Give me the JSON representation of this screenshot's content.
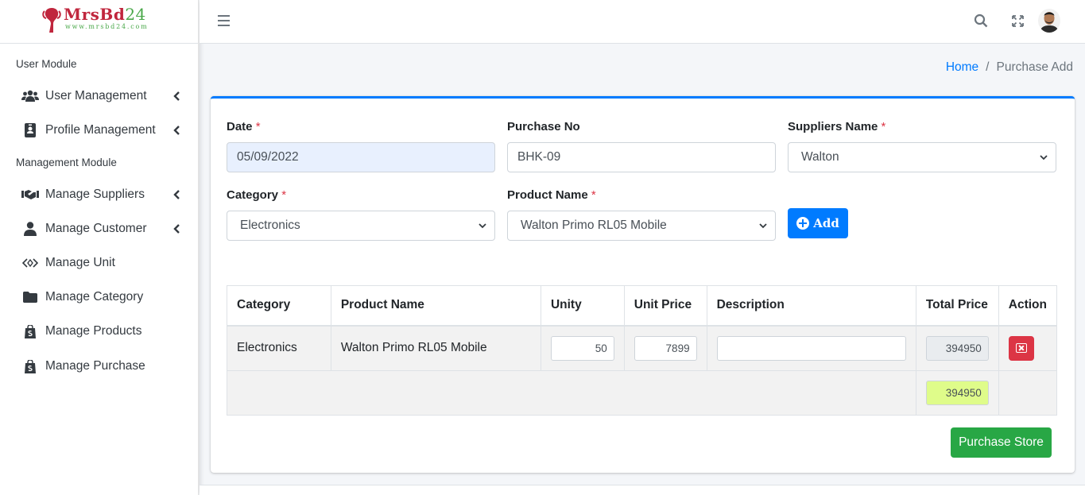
{
  "brand": {
    "name": "MrsBd",
    "number": "24",
    "url": "www.mrsbd24.com"
  },
  "sidebar": {
    "sections": [
      {
        "header": "User Module"
      },
      {
        "header": "Management Module"
      }
    ],
    "items": [
      {
        "label": "User Management",
        "icon": "users-icon",
        "has_children": true
      },
      {
        "label": "Profile Management",
        "icon": "id-badge-icon",
        "has_children": true
      },
      {
        "label": "Manage Suppliers",
        "icon": "handshake-icon",
        "has_children": true
      },
      {
        "label": "Manage Customer",
        "icon": "user-icon",
        "has_children": true
      },
      {
        "label": "Manage Unit",
        "icon": "code-icon",
        "has_children": false
      },
      {
        "label": "Manage Category",
        "icon": "folder-icon",
        "has_children": false
      },
      {
        "label": "Manage Products",
        "icon": "shopify-bag-icon",
        "has_children": false
      },
      {
        "label": "Manage Purchase",
        "icon": "shopify-bag-icon",
        "has_children": false
      }
    ]
  },
  "breadcrumb": {
    "home": "Home",
    "separator": "/",
    "current": "Purchase Add"
  },
  "form": {
    "date": {
      "label": "Date",
      "required": "*",
      "value": "05/09/2022"
    },
    "purchase_no": {
      "label": "Purchase No",
      "value": "BHK-09"
    },
    "supplier": {
      "label": "Suppliers Name",
      "required": "*",
      "value": "Walton"
    },
    "category": {
      "label": "Category",
      "required": "*",
      "value": "Electronics"
    },
    "product": {
      "label": "Product Name",
      "required": "*",
      "value": "Walton Primo RL05 Mobile"
    },
    "add_label": "Add"
  },
  "table": {
    "headers": [
      "Category",
      "Product Name",
      "Unity",
      "Unit Price",
      "Description",
      "Total Price",
      "Action"
    ],
    "rows": [
      {
        "category": "Electronics",
        "product": "Walton Primo RL05 Mobile",
        "unity": "50",
        "unit_price": "7899",
        "description": "",
        "total": "394950"
      }
    ],
    "grand_total": "394950"
  },
  "store_label": "Purchase Store",
  "colors": {
    "primary": "#007bff",
    "success": "#28a745",
    "danger": "#dc3545",
    "highlight": "#dffc8a"
  }
}
